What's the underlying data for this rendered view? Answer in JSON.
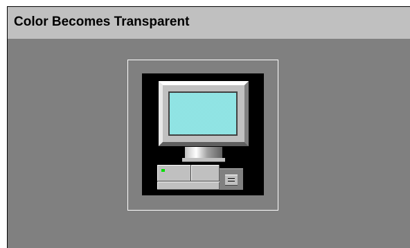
{
  "window": {
    "title": "Color Becomes Transparent"
  },
  "preview": {
    "icon": "computer-icon",
    "colors": {
      "transparent_color": "#000000",
      "background": "#808080",
      "screen": "#a0ffff",
      "monitor_body": "#c0c0c0"
    }
  }
}
